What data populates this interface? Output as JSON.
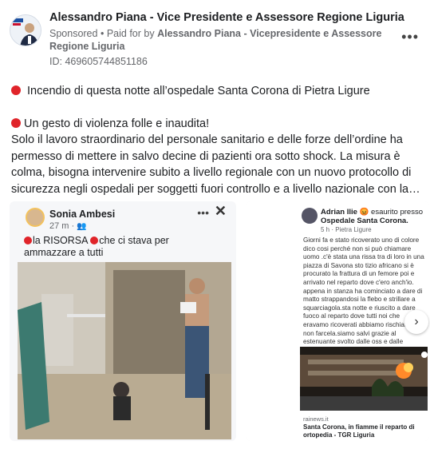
{
  "header": {
    "page_name": "Alessandro Piana - Vice Presidente e Assessore Regione Liguria",
    "sponsored_label": "Sponsored",
    "separator": "•",
    "paid_for_prefix": "Paid for by",
    "paid_for_name": "Alessandro Piana - Vicepresidente e Assessore Regione Liguria",
    "ad_id": "ID: 469605744851186",
    "more_icon": "more-horizontal-icon"
  },
  "post": {
    "line1": "Incendio di questa notte all’ospedale Santa Corona di Pietra Ligure",
    "line2": "Un gesto di violenza folle e inaudita!",
    "body": "Solo il lavoro straordinario del personale sanitario e delle forze dell’ordine ha permesso di mettere in salvo decine di pazienti ora sotto shock. La misura è colma, bisogna intervenire subito a livello regionale con un nuovo protocollo di sicurezza negli ospedali per soggetti fuori controllo e a livello nazionale con la…"
  },
  "card1": {
    "author": "Sonia Ambesi",
    "time": "27 m ·",
    "text_part1": "la RISORSA",
    "text_part2": "che ci stava per ammazzare a tutti"
  },
  "card2": {
    "author": "Adrian Ilie",
    "feeling": "😡 esaurito presso",
    "page": "Ospedale Santa Corona.",
    "time": "5 h · Pietra Ligure",
    "text": "Giorni fa e stato ricoverato uno di colore dico cosi perché non si può chiamare uomo .c'è stata una rissa tra di loro in una piazza di Savona sto tizio africano si è procurato la frattura di un femore poi e arrivato nel reparto dove c'ero anch'io. appena in stanza ha cominciato a dare di matto strappandosi la flebo e strillare a squarciagola.sta notte e riuscito a dare fuoco al reparto dove tutti noi che eravamo ricoverati abbiamo rischiato di non farcela.siamo salvi grazie al estenuante svolto dalle oss e dalle infermiere. Grazie di cuore ❤️.se dovevamo aspettare i vigili del fuoco ..............",
    "source": "rainews.it",
    "link_title": "Santa Corona, in fiamme il reparto di ortopedia - TGR Liguria"
  },
  "colors": {
    "red_dot": "#e0242a",
    "text": "#1c1e21",
    "secondary": "#65676b"
  }
}
